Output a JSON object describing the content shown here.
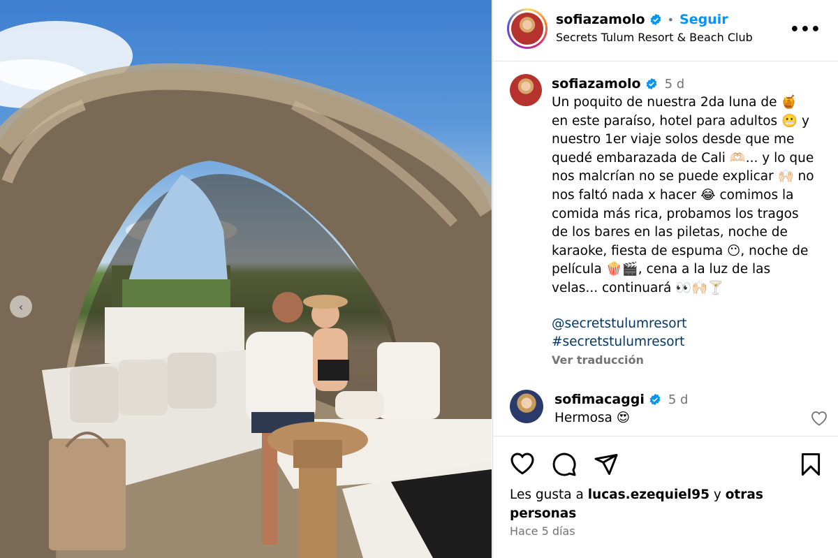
{
  "post": {
    "author": "sofiazamolo",
    "follow_label": "Seguir",
    "separator": "•",
    "location": "Secrets Tulum Resort & Beach Club",
    "more_label": "•••"
  },
  "caption": {
    "author": "sofiazamolo",
    "time": "5 d",
    "text": "Un poquito de nuestra 2da luna de 🍯\nen este paraíso, hotel para adultos 😬 y\nnuestro 1er viaje solos desde que me\nquedé embarazada de Cali 🫶🏻... y lo que\nnos malcrían no se puede explicar 🙌🏻 no\nnos faltó nada x hacer 😂 comimos la\ncomida más rica, probamos los tragos\nde los bares en las piletas, noche de\nkaraoke, fiesta de espuma 😶, noche de\npelícula 🍿🎬, cena a la luz de las\nvelas... continuará 👀🙌🏻🍸",
    "hashtags": [
      "@secretstulumresort",
      "#secretstulumresort"
    ],
    "translate_label": "Ver traducción"
  },
  "comment": {
    "author": "sofimacaggi",
    "time": "5 d",
    "text": "Hermosa 😍"
  },
  "likes": {
    "prefix": "Les gusta a",
    "user": "lucas.ezequiel95",
    "connector": "y",
    "suffix": "otras personas"
  },
  "date_label": "Hace 5 días",
  "icons": {
    "verified": "verified-badge-icon",
    "like": "heart-icon",
    "comment": "comment-icon",
    "share": "share-icon",
    "save": "bookmark-icon",
    "carousel": "chevron-left-icon"
  },
  "colors": {
    "follow": "#0095f6",
    "hashtag": "#00376b",
    "muted": "#737373",
    "verified": "#0095f6"
  }
}
